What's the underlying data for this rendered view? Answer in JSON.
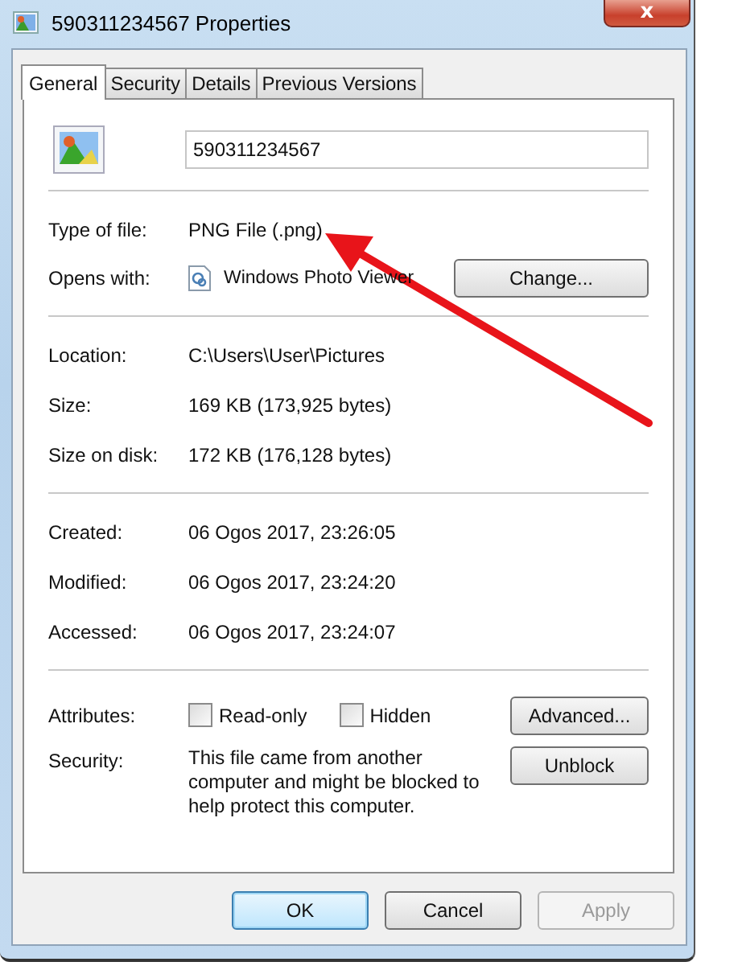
{
  "window": {
    "title": "590311234567 Properties",
    "close": "x"
  },
  "tabs": [
    {
      "label": "General",
      "selected": true
    },
    {
      "label": "Security",
      "selected": false
    },
    {
      "label": "Details",
      "selected": false
    },
    {
      "label": "Previous Versions",
      "selected": false
    }
  ],
  "file_name": "590311234567",
  "type_of_file": {
    "label": "Type of file:",
    "value": "PNG File (.png)"
  },
  "opens_with": {
    "label": "Opens with:",
    "value": "Windows Photo Viewer",
    "button": "Change..."
  },
  "location_group": [
    {
      "label": "Location:",
      "value": "C:\\Users\\User\\Pictures"
    },
    {
      "label": "Size:",
      "value": "169 KB (173,925 bytes)"
    },
    {
      "label": "Size on disk:",
      "value": "172 KB (176,128 bytes)"
    }
  ],
  "dates_group": [
    {
      "label": "Created:",
      "value": "06 Ogos 2017, 23:26:05"
    },
    {
      "label": "Modified:",
      "value": "06 Ogos 2017, 23:24:20"
    },
    {
      "label": "Accessed:",
      "value": "06 Ogos 2017, 23:24:07"
    }
  ],
  "attributes": {
    "label": "Attributes:",
    "checkboxes": [
      {
        "label": "Read-only",
        "checked": false
      },
      {
        "label": "Hidden",
        "checked": false
      }
    ],
    "button": "Advanced..."
  },
  "security": {
    "label": "Security:",
    "text": "This file came from another computer and might be blocked to help protect this computer.",
    "button": "Unblock"
  },
  "buttons": [
    {
      "label": "OK",
      "default": true,
      "disabled": false
    },
    {
      "label": "Cancel",
      "default": false,
      "disabled": false
    },
    {
      "label": "Apply",
      "default": false,
      "disabled": true
    }
  ]
}
